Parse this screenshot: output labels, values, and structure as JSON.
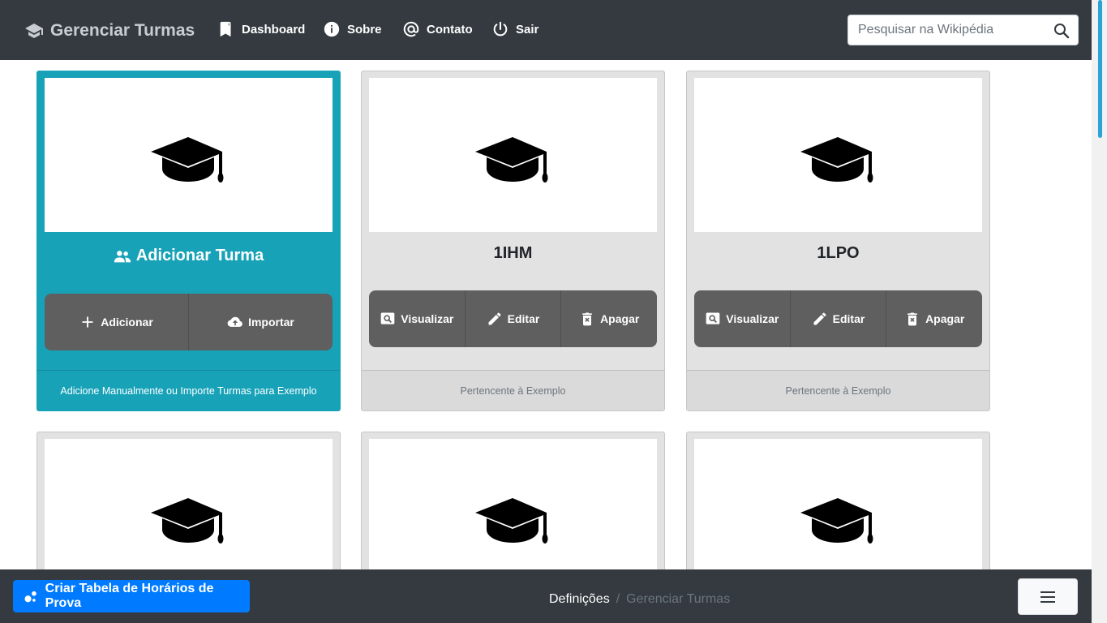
{
  "navbar": {
    "brand": "Gerenciar Turmas",
    "brand_icon": "graduation-cap-icon",
    "items": [
      {
        "label": "Dashboard",
        "icon": "bookmark-icon"
      },
      {
        "label": "Sobre",
        "icon": "info-icon"
      },
      {
        "label": "Contato",
        "icon": "at-sign-icon"
      },
      {
        "label": "Sair",
        "icon": "power-icon"
      }
    ],
    "search": {
      "placeholder": "Pesquisar na Wikipédia",
      "value": ""
    }
  },
  "cards": [
    {
      "title": "Adicionar Turma",
      "title_icon": "people-icon",
      "buttons": [
        {
          "label": "Adicionar",
          "icon": "plus-icon"
        },
        {
          "label": "Importar",
          "icon": "cloud-upload-icon"
        }
      ],
      "footer": "Adicione Manualmente ou Importe Turmas para Exemplo"
    },
    {
      "title": "1IHM",
      "buttons": [
        {
          "label": "Visualizar",
          "icon": "search-icon"
        },
        {
          "label": "Editar",
          "icon": "pencil-icon"
        },
        {
          "label": "Apagar",
          "icon": "trash-icon"
        }
      ],
      "footer": "Pertencente à Exemplo"
    },
    {
      "title": "1LPO",
      "buttons": [
        {
          "label": "Visualizar",
          "icon": "search-icon"
        },
        {
          "label": "Editar",
          "icon": "pencil-icon"
        },
        {
          "label": "Apagar",
          "icon": "trash-icon"
        }
      ],
      "footer": "Pertencente à Exemplo"
    }
  ],
  "bottombar": {
    "cta_label": "Criar Tabela de Horários de Prova",
    "breadcrumb": [
      "Definições",
      "Gerenciar Turmas"
    ],
    "menu_icon": "hamburger-menu-icon"
  },
  "colors": {
    "navbar": "#343a40",
    "primary_card": "#17a2b8",
    "card": "#e2e2e2",
    "button_group": "#5f5f5f",
    "cta": "#007bff"
  }
}
